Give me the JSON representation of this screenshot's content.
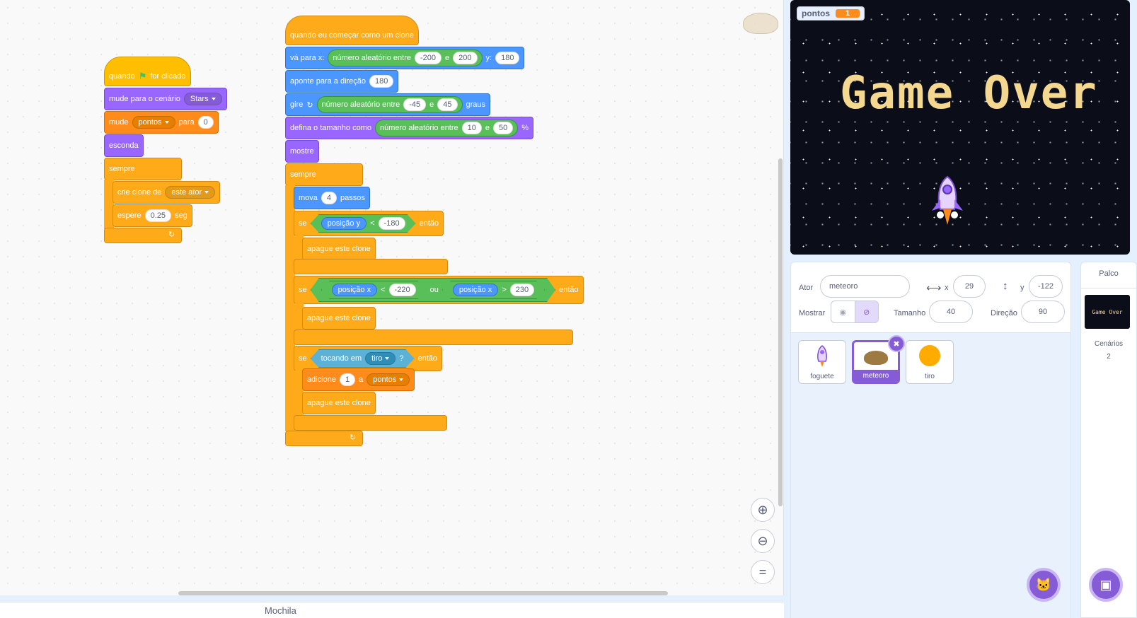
{
  "script1": {
    "when": "quando",
    "clicked": "for clicado",
    "switch_backdrop": "mude para o cenário",
    "backdrop": "Stars",
    "set": "mude",
    "set_var": "pontos",
    "to": "para",
    "set_value": "0",
    "hide": "esconda",
    "forever": "sempre",
    "create_clone": "crie clone de",
    "clone_target": "este ator",
    "wait": "espere",
    "wait_value": "0.25",
    "seconds": "seg"
  },
  "script2": {
    "hat": "quando eu começar como um clone",
    "goto": "vá para x:",
    "random": "número aleatório entre",
    "goto_min": "-200",
    "and": "e",
    "goto_max": "200",
    "y": "y:",
    "goto_y": "180",
    "point": "aponte para a direção",
    "point_value": "180",
    "turn": "gire",
    "turn_min": "-45",
    "turn_max": "45",
    "degrees": "graus",
    "set_size": "defina o tamanho como",
    "size_min": "10",
    "size_max": "50",
    "percent": "%",
    "show": "mostre",
    "forever": "sempre",
    "move": "mova",
    "move_value": "4",
    "steps": "passos",
    "if": "se",
    "then": "então",
    "pos_y": "posição y",
    "lt": "<",
    "gt": ">",
    "y_limit": "-180",
    "delete_clone": "apague este clone",
    "pos_x": "posição x",
    "x_min": "-220",
    "or": "ou",
    "x_max": "230",
    "touching": "tocando em",
    "touch_target": "tiro",
    "question": "?",
    "add": "adicione",
    "add_value": "1",
    "to_var": "a",
    "add_var": "pontos"
  },
  "stage": {
    "monitor_label": "pontos",
    "monitor_value": "1",
    "overlay_text": "Game Over"
  },
  "sprite_info": {
    "sprite_label": "Ator",
    "sprite_name": "meteoro",
    "x_label": "x",
    "x_value": "29",
    "y_label": "y",
    "y_value": "-122",
    "show_label": "Mostrar",
    "size_label": "Tamanho",
    "size_value": "40",
    "direction_label": "Direção",
    "direction_value": "90"
  },
  "sprites": [
    {
      "name": "foguete"
    },
    {
      "name": "meteoro"
    },
    {
      "name": "tiro"
    }
  ],
  "target_panel": {
    "title": "Palco",
    "thumb_text": "Game Over",
    "backdrops_label": "Cenários",
    "backdrops_count": "2"
  },
  "backpack": {
    "label": "Mochila"
  },
  "colors": {
    "events": "#ffbf00",
    "looks": "#9966ff",
    "variables": "#ff8c1a",
    "control": "#ffab19",
    "motion": "#4c97ff",
    "operators": "#59c059",
    "sensing": "#5cb1d6",
    "selection": "#855cd6"
  },
  "icons": {
    "zoom_in": "zoom-in-icon",
    "zoom_out": "zoom-out-icon",
    "zoom_reset": "zoom-reset-icon"
  }
}
